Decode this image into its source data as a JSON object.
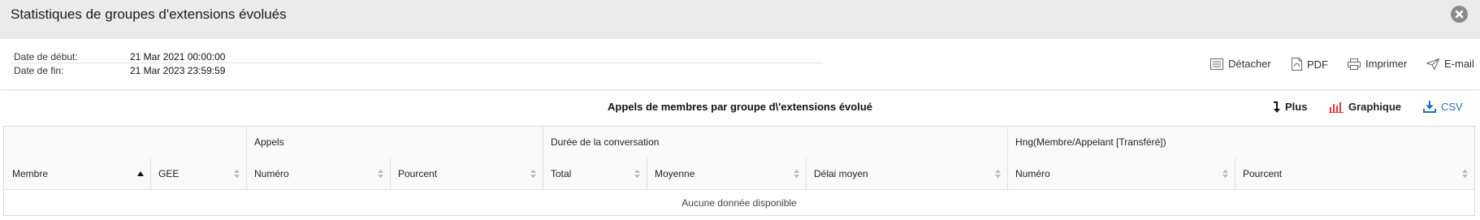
{
  "window": {
    "title": "Statistiques de groupes d'extensions évolués"
  },
  "filters": {
    "start_label": "Date de début:",
    "start_value": "21 Mar 2021 00:00:00",
    "end_label": "Date de fin:",
    "end_value": "21 Mar 2023 23:59:59"
  },
  "actions": {
    "detach": "Détacher",
    "pdf": "PDF",
    "print": "Imprimer",
    "email": "E-mail"
  },
  "report": {
    "title": "Appels de membres par groupe d\\'extensions évolué",
    "tools": {
      "more": "Plus",
      "chart": "Graphique",
      "csv": "CSV"
    }
  },
  "table": {
    "groups": {
      "calls": "Appels",
      "duration": "Durée de la conversation",
      "hng": "Hng(Membre/Appelant [Transféré])"
    },
    "columns": {
      "member": "Membre",
      "gee": "GEE",
      "calls_number": "Numéro",
      "calls_percent": "Pourcent",
      "dur_total": "Total",
      "dur_avg": "Moyenne",
      "dur_delay": "Délai moyen",
      "hng_number": "Numéro",
      "hng_percent": "Pourcent"
    },
    "empty_message": "Aucune donnée disponible"
  },
  "colors": {
    "title_bar": "#ebebeb",
    "chart_icon": "#e53935",
    "csv_accent": "#1e73be"
  }
}
